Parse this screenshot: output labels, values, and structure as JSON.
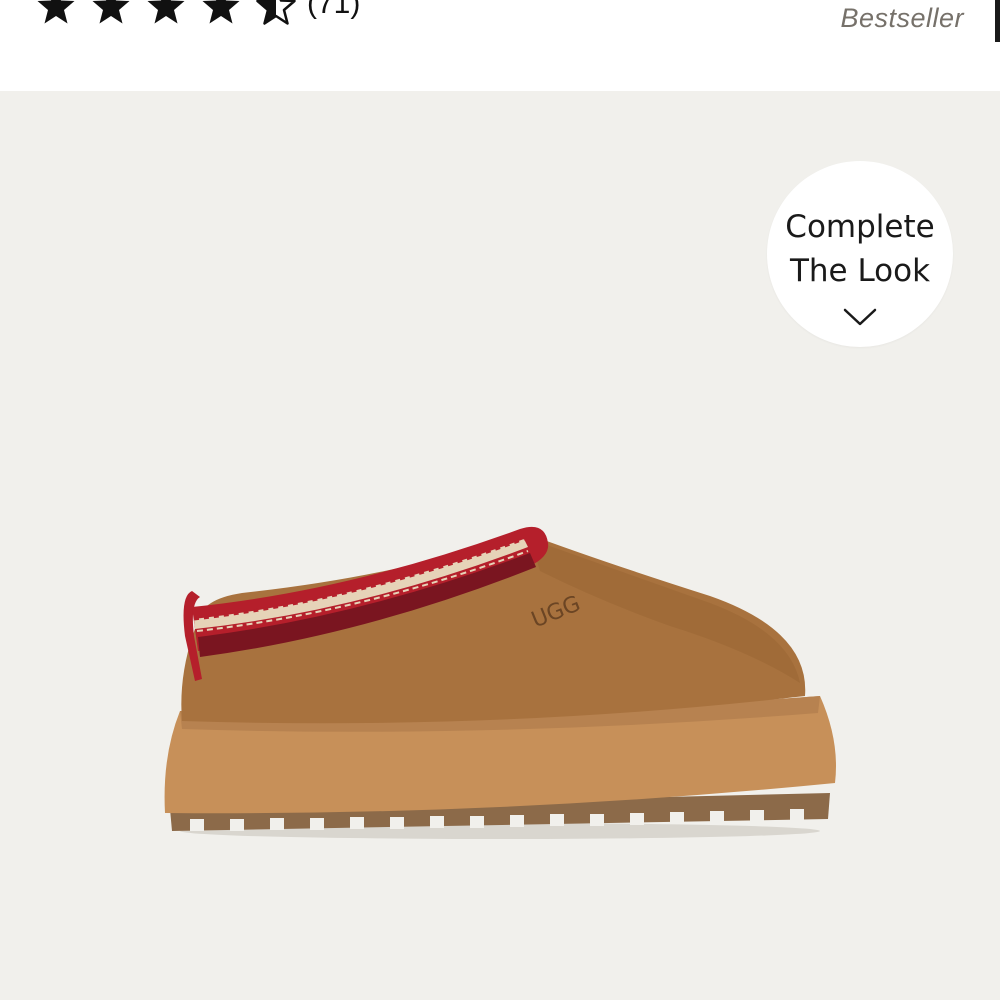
{
  "header": {
    "rating": {
      "value": 4.5,
      "max": 5,
      "review_count_label": "(71)"
    },
    "badge": "Bestseller"
  },
  "product": {
    "image_icon": "clog-slipper-product-image",
    "brand_mark": "UGG",
    "complete_look": {
      "line1": "Complete",
      "line2": "The Look",
      "icon": "chevron-down-icon"
    }
  },
  "colors": {
    "page_background": "#ffffff",
    "product_background": "#f1f0ec",
    "badge_text": "#76716a",
    "star": "#111111",
    "suede": "#a8723e",
    "sole": "#c8925d",
    "trim_red": "#b51f2b"
  }
}
